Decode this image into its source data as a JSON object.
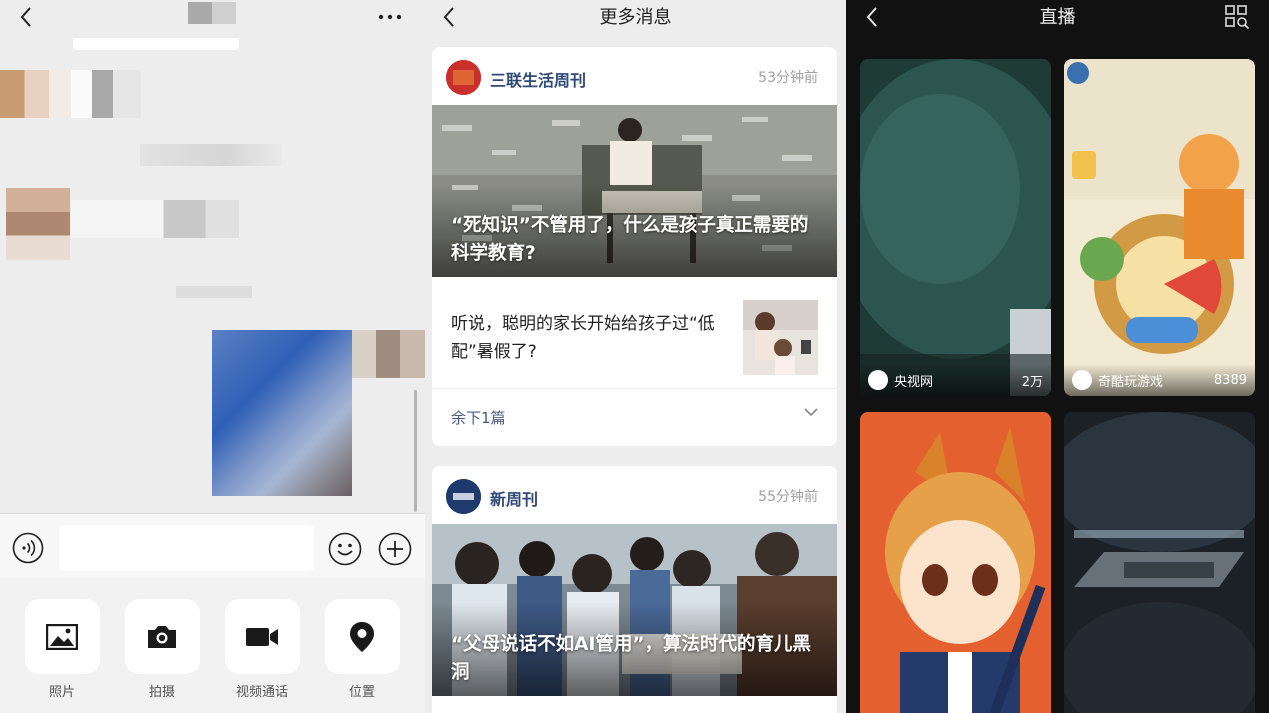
{
  "chat": {
    "tools": [
      {
        "label": "照片",
        "icon": "image-icon"
      },
      {
        "label": "拍摄",
        "icon": "camera-icon"
      },
      {
        "label": "视频通话",
        "icon": "video-call-icon"
      },
      {
        "label": "位置",
        "icon": "location-pin-icon"
      }
    ]
  },
  "news": {
    "title": "更多消息",
    "cards": [
      {
        "publisher": "三联生活周刊",
        "time": "53分钟前",
        "headline": "“死知识”不管用了，什么是孩子真正需要的科学教育?",
        "sub_title": "听说，聪明的家长开始给孩子过“低配”暑假了?",
        "remaining": "余下1篇"
      },
      {
        "publisher": "新周刊",
        "time": "55分钟前",
        "headline": "“父母说话不如AI管用”，算法时代的育儿黑洞"
      }
    ]
  },
  "live": {
    "title": "直播",
    "tiles": [
      {
        "name": "央视网",
        "count": "2万"
      },
      {
        "name": "奇酷玩游戏",
        "count": "8389"
      },
      {
        "name": "",
        "count": ""
      },
      {
        "name": "",
        "count": ""
      }
    ]
  }
}
